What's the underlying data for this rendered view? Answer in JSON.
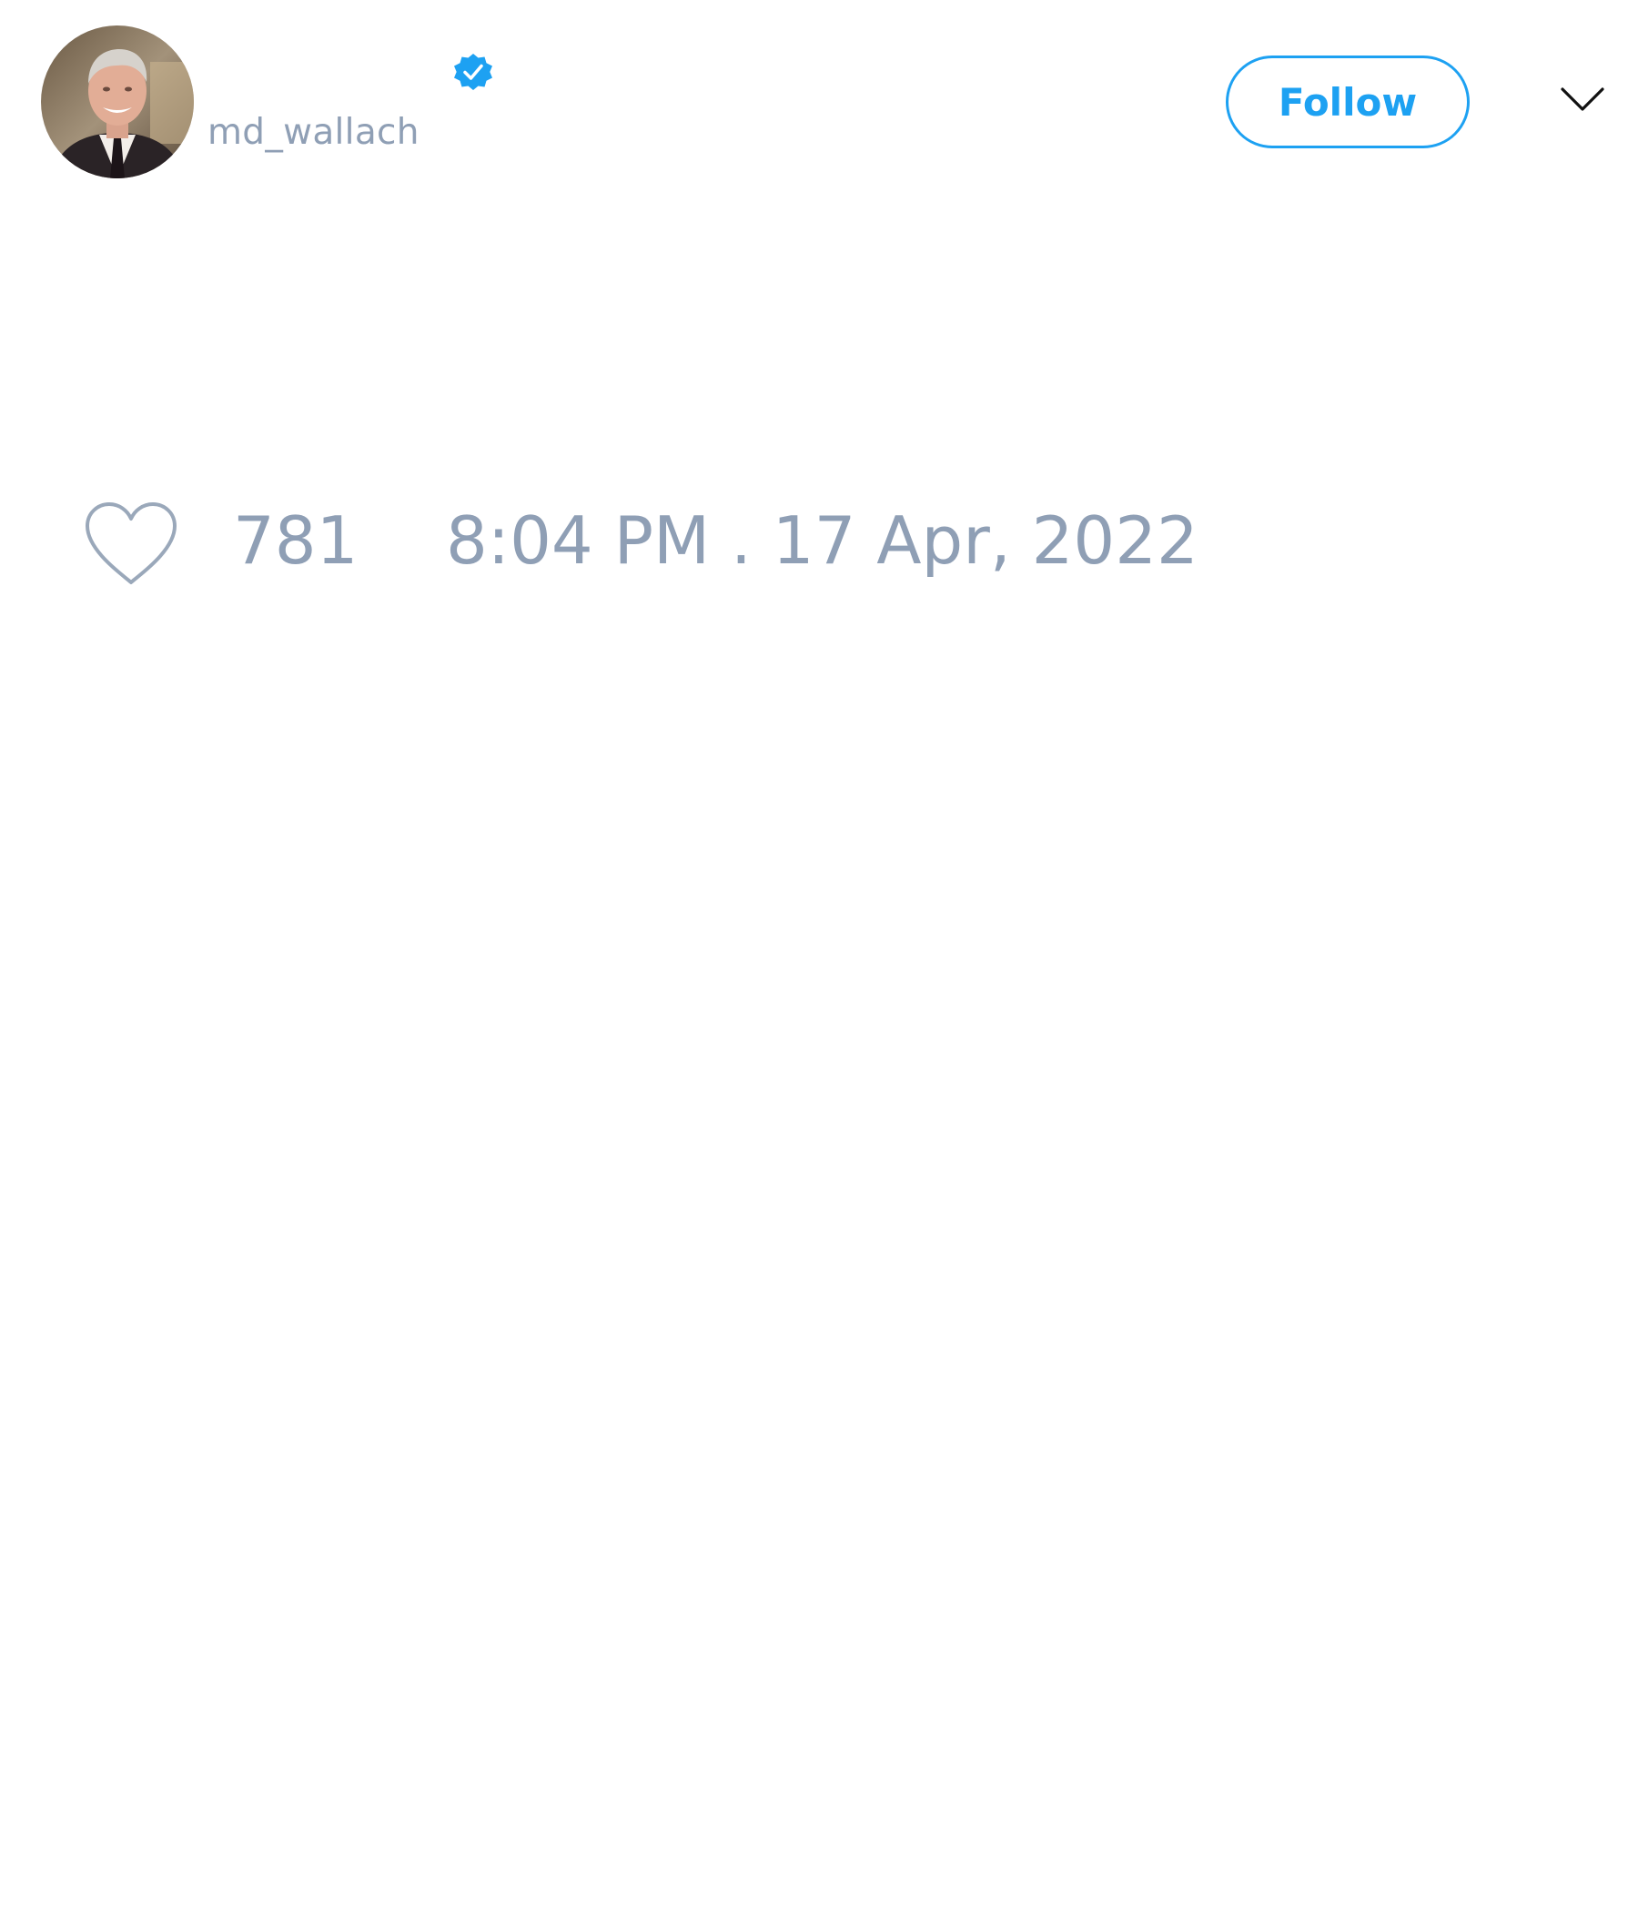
{
  "author": {
    "handle": "md_wallach",
    "verified": true,
    "avatar": "avatar-photo"
  },
  "header": {
    "follow_label": "Follow",
    "menu_icon": "chevron-down-icon"
  },
  "stats": {
    "like_icon": "heart-icon",
    "likes": "781",
    "timestamp": "8:04 PM . 17 Apr, 2022"
  },
  "colors": {
    "accent": "#1da1f2",
    "muted_text": "#8f9fb5",
    "icon_outline": "#9aa8ba",
    "background": "#ffffff"
  }
}
